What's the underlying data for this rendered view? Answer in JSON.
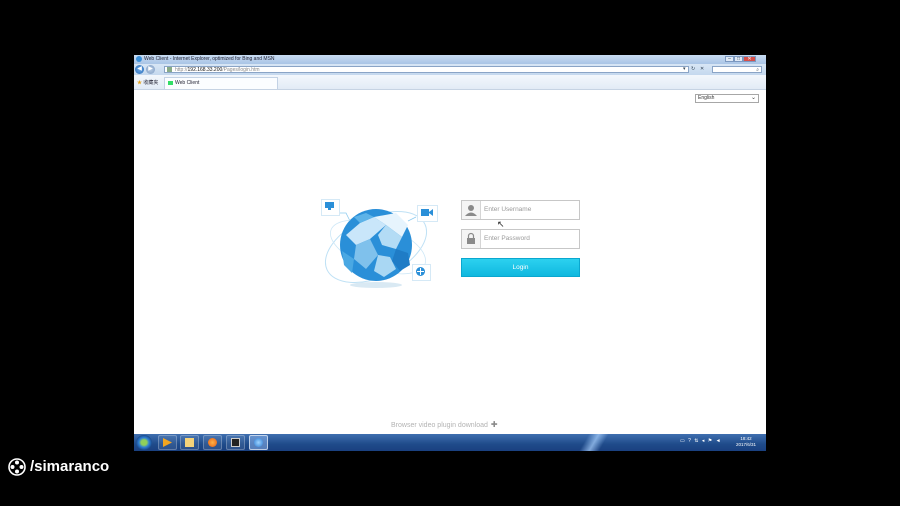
{
  "browser": {
    "window_title": "Web Client - Internet Explorer, optimized for Bing and MSN",
    "address": {
      "protocol": "http://",
      "host": "192.168.33.200",
      "path": "/Pages/login.htm"
    },
    "favorites_label": "收藏夹",
    "tab_title": "Web Client",
    "window_buttons": [
      "–",
      "□",
      "✕"
    ]
  },
  "page": {
    "language": {
      "selected": "English"
    },
    "login": {
      "username_placeholder": "Enter Username",
      "password_placeholder": "Enter Password",
      "login_label": "Login"
    },
    "plugin_link": "Browser video plugin download"
  },
  "taskbar": {
    "clock_time": "18:42",
    "clock_date": "2017/6/31",
    "apps": [
      "explorer-folder",
      "media-player",
      "file-manager",
      "firefox",
      "video-app",
      "internet-explorer"
    ]
  },
  "watermark": {
    "text": "/simaranco"
  },
  "colors": {
    "accent": "#12bde3",
    "globe": "#2a8fd8",
    "taskbar": "#1f4b8a"
  }
}
